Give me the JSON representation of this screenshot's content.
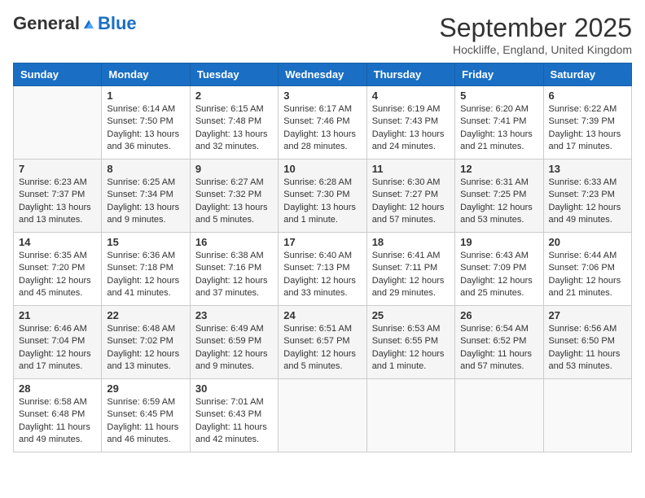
{
  "header": {
    "logo_general": "General",
    "logo_blue": "Blue",
    "month_year": "September 2025",
    "location": "Hockliffe, England, United Kingdom"
  },
  "calendar": {
    "weekdays": [
      "Sunday",
      "Monday",
      "Tuesday",
      "Wednesday",
      "Thursday",
      "Friday",
      "Saturday"
    ],
    "weeks": [
      [
        {
          "day": null,
          "sunrise": null,
          "sunset": null,
          "daylight": null
        },
        {
          "day": "1",
          "sunrise": "6:14 AM",
          "sunset": "7:50 PM",
          "daylight": "13 hours and 36 minutes."
        },
        {
          "day": "2",
          "sunrise": "6:15 AM",
          "sunset": "7:48 PM",
          "daylight": "13 hours and 32 minutes."
        },
        {
          "day": "3",
          "sunrise": "6:17 AM",
          "sunset": "7:46 PM",
          "daylight": "13 hours and 28 minutes."
        },
        {
          "day": "4",
          "sunrise": "6:19 AM",
          "sunset": "7:43 PM",
          "daylight": "13 hours and 24 minutes."
        },
        {
          "day": "5",
          "sunrise": "6:20 AM",
          "sunset": "7:41 PM",
          "daylight": "13 hours and 21 minutes."
        },
        {
          "day": "6",
          "sunrise": "6:22 AM",
          "sunset": "7:39 PM",
          "daylight": "13 hours and 17 minutes."
        }
      ],
      [
        {
          "day": "7",
          "sunrise": "6:23 AM",
          "sunset": "7:37 PM",
          "daylight": "13 hours and 13 minutes."
        },
        {
          "day": "8",
          "sunrise": "6:25 AM",
          "sunset": "7:34 PM",
          "daylight": "13 hours and 9 minutes."
        },
        {
          "day": "9",
          "sunrise": "6:27 AM",
          "sunset": "7:32 PM",
          "daylight": "13 hours and 5 minutes."
        },
        {
          "day": "10",
          "sunrise": "6:28 AM",
          "sunset": "7:30 PM",
          "daylight": "13 hours and 1 minute."
        },
        {
          "day": "11",
          "sunrise": "6:30 AM",
          "sunset": "7:27 PM",
          "daylight": "12 hours and 57 minutes."
        },
        {
          "day": "12",
          "sunrise": "6:31 AM",
          "sunset": "7:25 PM",
          "daylight": "12 hours and 53 minutes."
        },
        {
          "day": "13",
          "sunrise": "6:33 AM",
          "sunset": "7:23 PM",
          "daylight": "12 hours and 49 minutes."
        }
      ],
      [
        {
          "day": "14",
          "sunrise": "6:35 AM",
          "sunset": "7:20 PM",
          "daylight": "12 hours and 45 minutes."
        },
        {
          "day": "15",
          "sunrise": "6:36 AM",
          "sunset": "7:18 PM",
          "daylight": "12 hours and 41 minutes."
        },
        {
          "day": "16",
          "sunrise": "6:38 AM",
          "sunset": "7:16 PM",
          "daylight": "12 hours and 37 minutes."
        },
        {
          "day": "17",
          "sunrise": "6:40 AM",
          "sunset": "7:13 PM",
          "daylight": "12 hours and 33 minutes."
        },
        {
          "day": "18",
          "sunrise": "6:41 AM",
          "sunset": "7:11 PM",
          "daylight": "12 hours and 29 minutes."
        },
        {
          "day": "19",
          "sunrise": "6:43 AM",
          "sunset": "7:09 PM",
          "daylight": "12 hours and 25 minutes."
        },
        {
          "day": "20",
          "sunrise": "6:44 AM",
          "sunset": "7:06 PM",
          "daylight": "12 hours and 21 minutes."
        }
      ],
      [
        {
          "day": "21",
          "sunrise": "6:46 AM",
          "sunset": "7:04 PM",
          "daylight": "12 hours and 17 minutes."
        },
        {
          "day": "22",
          "sunrise": "6:48 AM",
          "sunset": "7:02 PM",
          "daylight": "12 hours and 13 minutes."
        },
        {
          "day": "23",
          "sunrise": "6:49 AM",
          "sunset": "6:59 PM",
          "daylight": "12 hours and 9 minutes."
        },
        {
          "day": "24",
          "sunrise": "6:51 AM",
          "sunset": "6:57 PM",
          "daylight": "12 hours and 5 minutes."
        },
        {
          "day": "25",
          "sunrise": "6:53 AM",
          "sunset": "6:55 PM",
          "daylight": "12 hours and 1 minute."
        },
        {
          "day": "26",
          "sunrise": "6:54 AM",
          "sunset": "6:52 PM",
          "daylight": "11 hours and 57 minutes."
        },
        {
          "day": "27",
          "sunrise": "6:56 AM",
          "sunset": "6:50 PM",
          "daylight": "11 hours and 53 minutes."
        }
      ],
      [
        {
          "day": "28",
          "sunrise": "6:58 AM",
          "sunset": "6:48 PM",
          "daylight": "11 hours and 49 minutes."
        },
        {
          "day": "29",
          "sunrise": "6:59 AM",
          "sunset": "6:45 PM",
          "daylight": "11 hours and 46 minutes."
        },
        {
          "day": "30",
          "sunrise": "7:01 AM",
          "sunset": "6:43 PM",
          "daylight": "11 hours and 42 minutes."
        },
        {
          "day": null,
          "sunrise": null,
          "sunset": null,
          "daylight": null
        },
        {
          "day": null,
          "sunrise": null,
          "sunset": null,
          "daylight": null
        },
        {
          "day": null,
          "sunrise": null,
          "sunset": null,
          "daylight": null
        },
        {
          "day": null,
          "sunrise": null,
          "sunset": null,
          "daylight": null
        }
      ]
    ]
  }
}
